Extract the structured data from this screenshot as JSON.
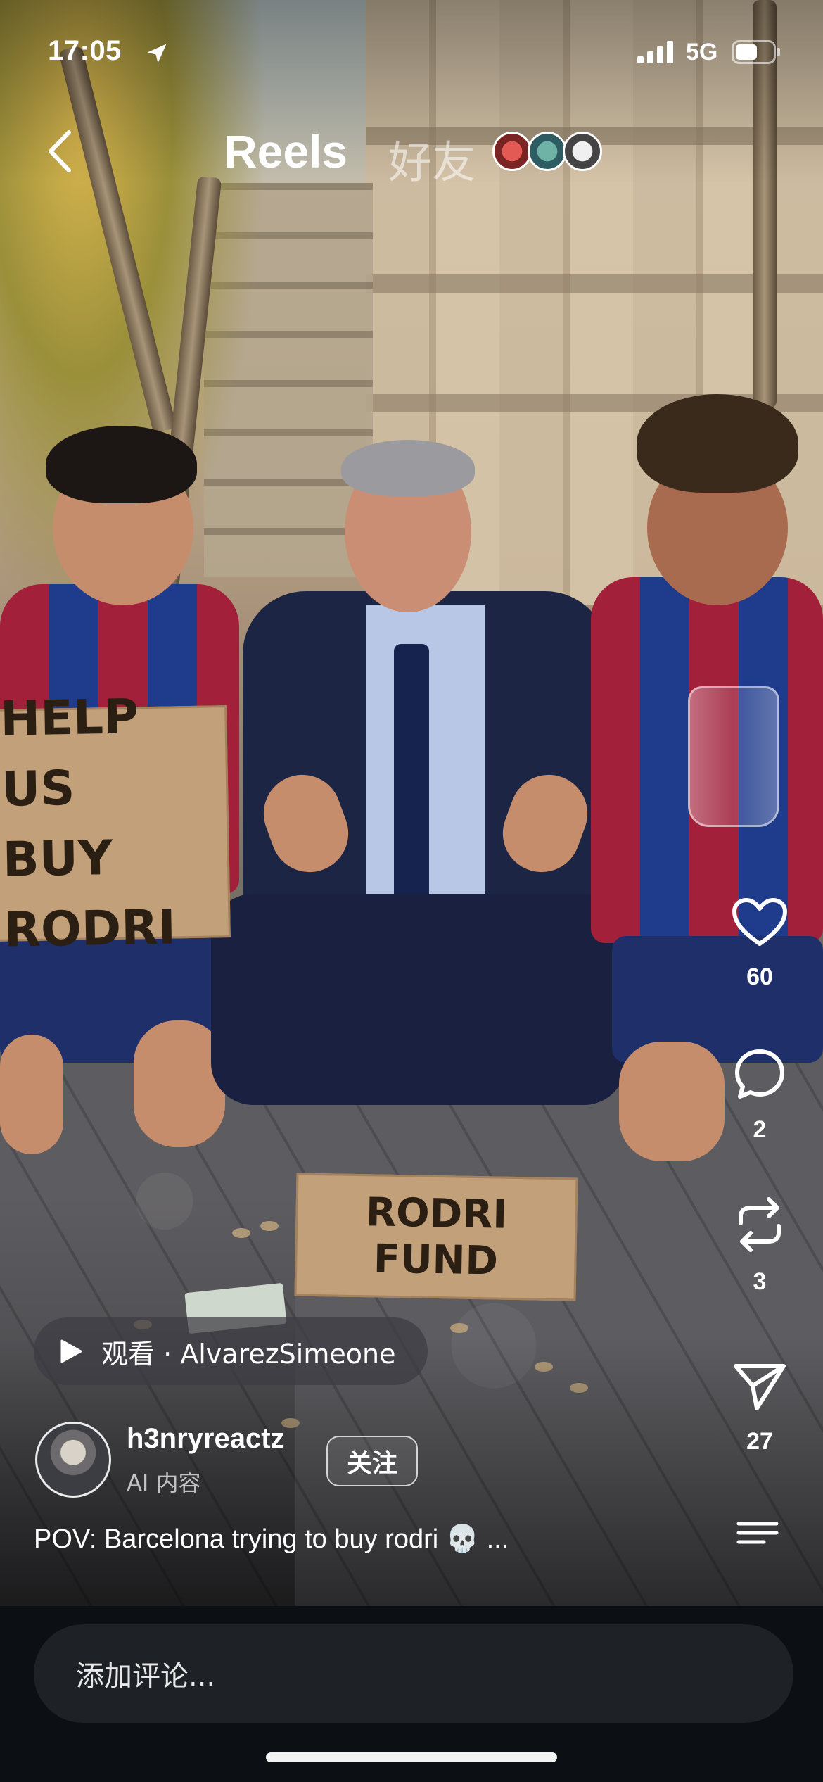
{
  "status_bar": {
    "time": "17:05",
    "location_icon": "location-arrow-icon",
    "signal_icon": "cellular-signal-icon",
    "network": "5G",
    "battery_icon": "battery-icon"
  },
  "header": {
    "back_icon": "chevron-left-icon",
    "title": "Reels",
    "friends_tab": "好友",
    "friend_avatars": [
      "avatar-1",
      "avatar-2",
      "avatar-3"
    ]
  },
  "video": {
    "sign_top_lines": [
      "HELP US",
      "BUY RODRI"
    ],
    "sign_bottom_lines": [
      "RODRI",
      "FUND"
    ]
  },
  "actions": {
    "like": {
      "icon": "heart-icon",
      "count": "60"
    },
    "comment": {
      "icon": "comment-bubble-icon",
      "count": "2"
    },
    "repost": {
      "icon": "repost-icon",
      "count": "3"
    },
    "share": {
      "icon": "send-paper-plane-icon",
      "count": "27"
    },
    "more": {
      "icon": "menu-lines-icon"
    }
  },
  "watch_chip": {
    "icon": "play-icon",
    "text": "观看 · AlvarezSimeone"
  },
  "creator": {
    "username": "h3nryreactz",
    "subtitle": "AI 内容",
    "follow_label": "关注"
  },
  "caption": "POV: Barcelona trying to buy rodri 💀  ...",
  "comment_bar": {
    "placeholder": "添加评论..."
  },
  "colors": {
    "comment_bar_bg": "#0c1014",
    "comment_input_bg": "#1e2226",
    "text": "#ffffff"
  }
}
